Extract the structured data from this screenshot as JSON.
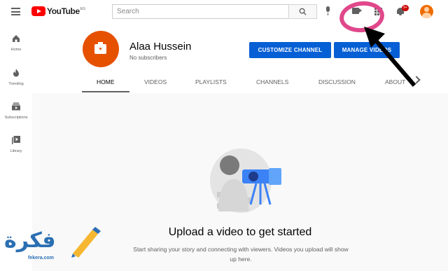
{
  "topbar": {
    "logo_text": "YouTube",
    "logo_region": "EG",
    "search_placeholder": "Search",
    "notification_count": "9+",
    "icons": [
      "menu-icon",
      "search-icon",
      "mic-icon",
      "create-video-icon",
      "apps-icon",
      "bell-icon",
      "avatar"
    ]
  },
  "sidebar": {
    "items": [
      {
        "label": "Home",
        "icon": "home-icon"
      },
      {
        "label": "Trending",
        "icon": "flame-icon"
      },
      {
        "label": "Subscriptions",
        "icon": "subscriptions-icon"
      },
      {
        "label": "Library",
        "icon": "library-icon"
      }
    ]
  },
  "channel": {
    "name": "Alaa Hussein",
    "subscribers": "No subscribers",
    "customize_label": "CUSTOMIZE CHANNEL",
    "manage_label": "MANAGE VIDEOS",
    "avatar_color": "#e65100"
  },
  "tabs": [
    "HOME",
    "VIDEOS",
    "PLAYLISTS",
    "CHANNELS",
    "DISCUSSION",
    "ABOUT"
  ],
  "empty_state": {
    "title": "Upload a video to get started",
    "description": "Start sharing your story and connecting with viewers. Videos you upload will show up here."
  },
  "watermark": {
    "text": "فكرة",
    "domain": "fekera.com"
  },
  "colors": {
    "accent": "#065fd4",
    "brand_red": "#ff0000",
    "annotation": "#e0488b"
  }
}
